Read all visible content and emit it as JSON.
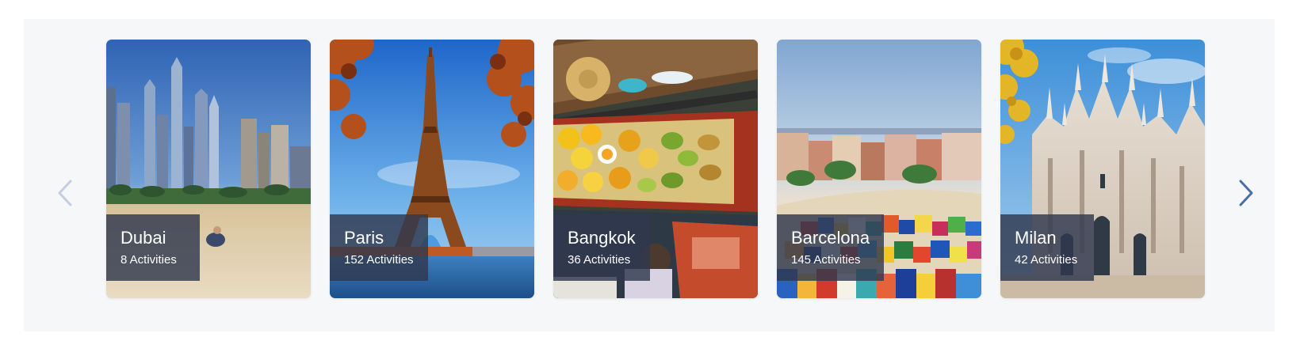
{
  "carousel": {
    "prev_icon": "chevron-left-icon",
    "next_icon": "chevron-right-icon",
    "prev_color": "#c5cde0",
    "next_color": "#4a6fa8",
    "cards": [
      {
        "city": "Dubai",
        "activities": "8 Activities"
      },
      {
        "city": "Paris",
        "activities": "152 Activities"
      },
      {
        "city": "Bangkok",
        "activities": "36 Activities"
      },
      {
        "city": "Barcelona",
        "activities": "145 Activities"
      },
      {
        "city": "Milan",
        "activities": "42 Activities"
      }
    ]
  }
}
